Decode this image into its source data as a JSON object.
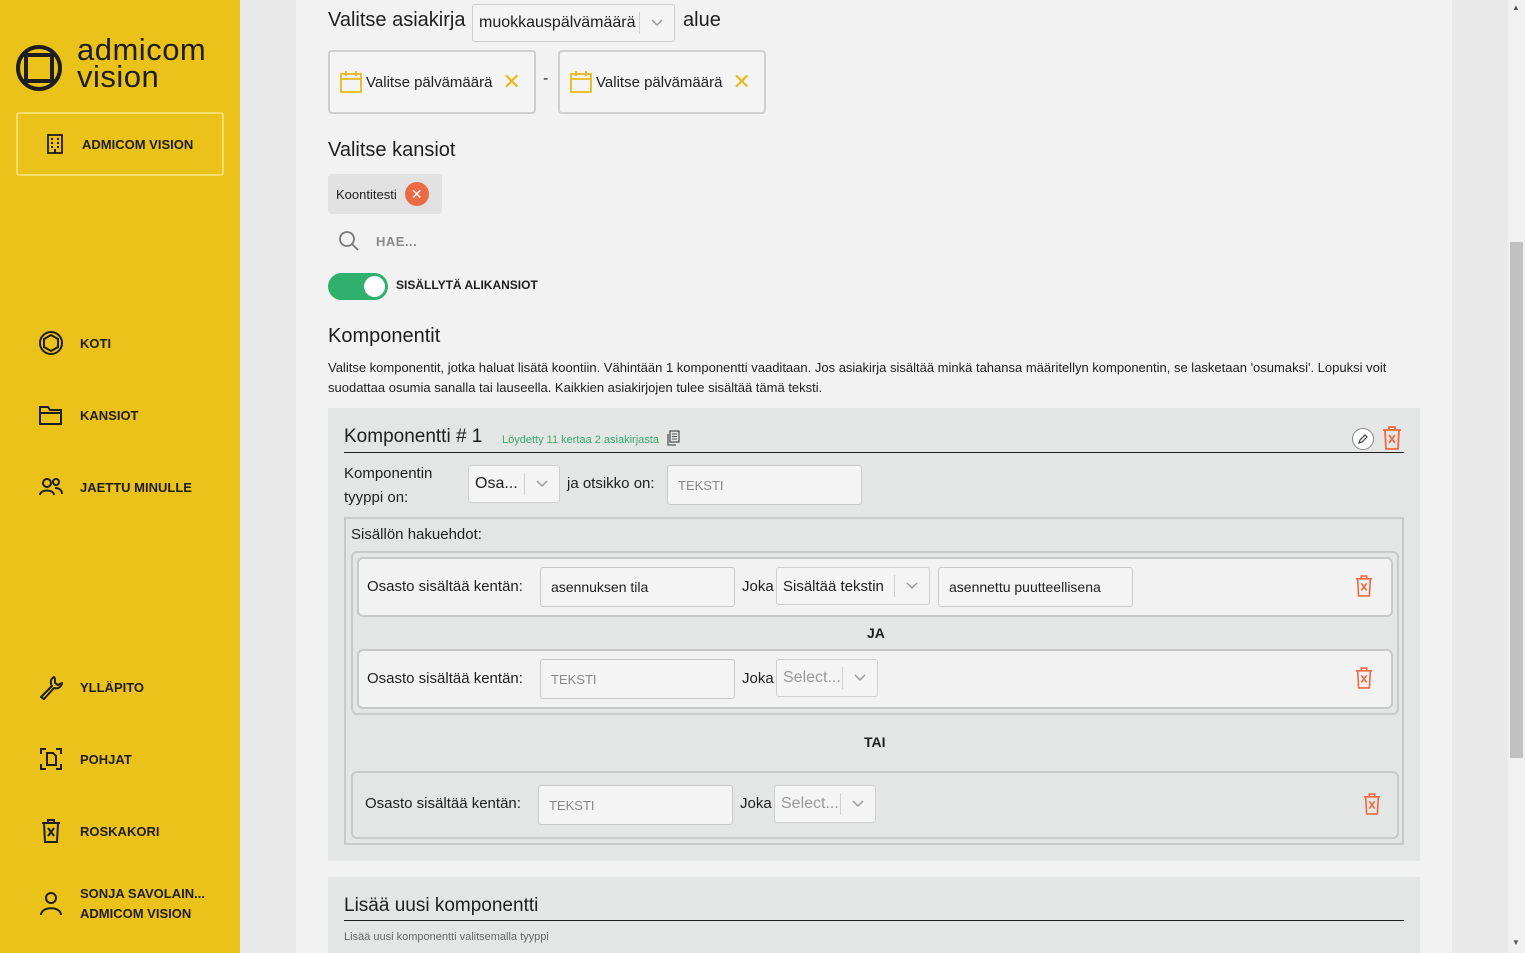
{
  "brand": {
    "line1": "admicom",
    "line2": "vision"
  },
  "sidebar": {
    "app_label": "ADMICOM VISION",
    "items": [
      {
        "label": "KOTI",
        "icon": "home-icon"
      },
      {
        "label": "KANSIOT",
        "icon": "folder-icon"
      },
      {
        "label": "JAETTU MINULLE",
        "icon": "users-icon"
      },
      {
        "label": "YLLÄPITO",
        "icon": "wrench-icon"
      },
      {
        "label": "POHJAT",
        "icon": "template-icon"
      },
      {
        "label": "ROSKAKORI",
        "icon": "trash-icon"
      }
    ],
    "user": {
      "name": "SONJA SAVOLAIN...",
      "org": "ADMICOM VISION"
    }
  },
  "doc_select": {
    "label": "Valitse asiakirja",
    "value": "muokkauspälvämäärä",
    "suffix": "alue",
    "date_from": "Valitse pälvämäärä",
    "date_sep": "-",
    "date_to": "Valitse pälvämäärä"
  },
  "folders": {
    "heading": "Valitse kansiot",
    "chip": "Koontitesti",
    "search_placeholder": "HAE...",
    "include_sub_label": "SISÄLLYTÄ ALIKANSIOT",
    "include_sub_on": true
  },
  "components": {
    "heading": "Komponentit",
    "description": "Valitse komponentit, jotka haluat lisätä koontiin. Vähintään 1 komponentti vaaditaan. Jos asiakirja sisältää minkä tahansa määritellyn komponentin, se lasketaan 'osumaksi'. Lopuksi voit suodattaa osumia sanalla tai lauseella. Kaikkien asiakirjojen tulee sisältää tämä teksti.",
    "component": {
      "title": "Komponentti # 1",
      "found": "Löydetty 11 kertaa 2 asiakirjasta",
      "type_label_1": "Komponentin",
      "type_label_2": "tyyppi on:",
      "type_value": "Osa...",
      "title_label": "ja otsikko on:",
      "title_placeholder": "TEKSTI",
      "criteria_heading": "Sisällön hakuehdot:",
      "and_label": "JA",
      "or_label": "TAI",
      "rows": [
        {
          "label": "Osasto sisältää kentän:",
          "field": "asennuksen tila",
          "joka": "Joka",
          "op": "Sisältää tekstin",
          "value": "asennettu puutteellisena"
        },
        {
          "label": "Osasto sisältää kentän:",
          "field_placeholder": "TEKSTI",
          "joka": "Joka",
          "op": "Select..."
        },
        {
          "label": "Osasto sisältää kentän:",
          "field_placeholder": "TEKSTI",
          "joka": "Joka",
          "op": "Select..."
        }
      ]
    }
  },
  "add_component": {
    "title": "Lisää uusi komponentti",
    "subtitle": "Lisää uusi komponentti valitsemalla tyyppi"
  },
  "colors": {
    "sidebar": "#ebc21a",
    "accent_green": "#2fb06d",
    "danger": "#ec6b45",
    "found_text": "#3aa86a"
  }
}
